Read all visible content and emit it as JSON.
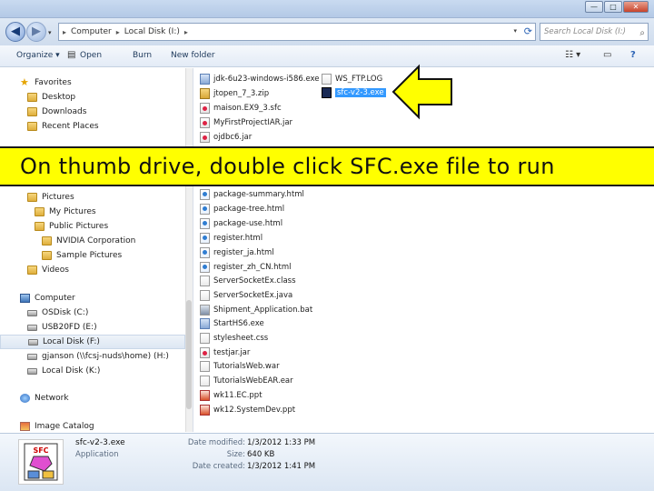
{
  "window": {
    "title": "",
    "minimize_glyph": "—",
    "maximize_glyph": "□",
    "close_glyph": "✕"
  },
  "address": {
    "back_glyph": "◀",
    "forward_glyph": "▶",
    "crumbs": [
      "Computer",
      "Local Disk (I:)"
    ],
    "separator": "▸",
    "search_placeholder": "Search Local Disk (I:)"
  },
  "toolbar": {
    "organize_label": "Organize ▾",
    "open_label": "Open",
    "burn_label": "Burn",
    "newfolder_label": "New folder"
  },
  "sidebar": {
    "items": [
      {
        "label": "Favorites",
        "icon": "star-icon"
      },
      {
        "label": "Desktop",
        "icon": "folder-icon"
      },
      {
        "label": "Downloads",
        "icon": "folder-icon"
      },
      {
        "label": "Recent Places",
        "icon": "folder-icon"
      },
      {
        "label": "Pictures",
        "icon": "folder-icon"
      },
      {
        "label": "My Pictures",
        "icon": "folder-icon"
      },
      {
        "label": "Public Pictures",
        "icon": "folder-icon"
      },
      {
        "label": "NVIDIA Corporation",
        "icon": "folder-icon"
      },
      {
        "label": "Sample Pictures",
        "icon": "folder-icon"
      },
      {
        "label": "Videos",
        "icon": "folder-icon"
      },
      {
        "label": "Computer",
        "icon": "computer-icon"
      },
      {
        "label": "OSDisk (C:)",
        "icon": "drive-icon"
      },
      {
        "label": "USB20FD (E:)",
        "icon": "drive-icon"
      },
      {
        "label": "Local Disk (F:)",
        "icon": "drive-icon"
      },
      {
        "label": "gjanson (\\\\fcsj-nuds\\home) (H:)",
        "icon": "drive-icon"
      },
      {
        "label": "Local Disk (K:)",
        "icon": "drive-icon"
      },
      {
        "label": "Network",
        "icon": "network-icon"
      },
      {
        "label": "Image Catalog",
        "icon": "image-icon"
      }
    ]
  },
  "files": {
    "col1": [
      {
        "name": "jdk-6u23-windows-i586.exe",
        "type": "exe"
      },
      {
        "name": "jtopen_7_3.zip",
        "type": "zip"
      },
      {
        "name": "maison.EX9_3.sfc",
        "type": "jar"
      },
      {
        "name": "MyFirstProjectIAR.jar",
        "type": "jar"
      },
      {
        "name": "ojdbc6.jar",
        "type": "jar"
      },
      {
        "name": "package-summary.html",
        "type": "html"
      },
      {
        "name": "package-tree.html",
        "type": "html"
      },
      {
        "name": "package-use.html",
        "type": "html"
      },
      {
        "name": "register.html",
        "type": "html"
      },
      {
        "name": "register_ja.html",
        "type": "html"
      },
      {
        "name": "register_zh_CN.html",
        "type": "html"
      },
      {
        "name": "ServerSocketEx.class",
        "type": "css"
      },
      {
        "name": "ServerSocketEx.java",
        "type": "css"
      },
      {
        "name": "Shipment_Application.bat",
        "type": "bat"
      },
      {
        "name": "StartHS6.exe",
        "type": "exe"
      },
      {
        "name": "stylesheet.css",
        "type": "css"
      },
      {
        "name": "testjar.jar",
        "type": "jar"
      },
      {
        "name": "TutorialsWeb.war",
        "type": "css"
      },
      {
        "name": "TutorialsWebEAR.ear",
        "type": "css"
      },
      {
        "name": "wk11.EC.ppt",
        "type": "ppt"
      },
      {
        "name": "wk12.SystemDev.ppt",
        "type": "ppt"
      }
    ],
    "col2": [
      {
        "name": "WS_FTP.LOG",
        "type": "css"
      },
      {
        "name": "sfc-v2-3.exe",
        "type": "selected-exe",
        "selected": true
      }
    ]
  },
  "banner": {
    "text": "On thumb drive, double click SFC.exe file to run"
  },
  "details": {
    "name": "sfc-v2-3.exe",
    "type": "Application",
    "modified_label": "Date modified:",
    "modified_value": "1/3/2012 1:33 PM",
    "size_label": "Size:",
    "size_value": "640 KB",
    "created_label": "Date created:",
    "created_value": "1/3/2012 1:41 PM",
    "thumb_text": "SFC"
  },
  "colors": {
    "banner_bg": "#ffff00",
    "arrow_fill": "#ffff00",
    "selection": "#3399ff"
  }
}
